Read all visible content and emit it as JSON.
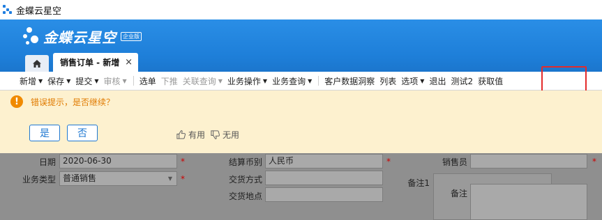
{
  "window": {
    "title": "金蝶云星空"
  },
  "header": {
    "brand": "金蝶云星空",
    "edition": "企业版",
    "active_tab": "销售订单 - 新增",
    "close_glyph": "×"
  },
  "toolbar": {
    "items": [
      {
        "label": "新增",
        "dropdown": true,
        "disabled": false
      },
      {
        "label": "保存",
        "dropdown": true,
        "disabled": false
      },
      {
        "label": "提交",
        "dropdown": true,
        "disabled": false
      },
      {
        "label": "审核",
        "dropdown": true,
        "disabled": true
      },
      {
        "label": "选单",
        "dropdown": false,
        "disabled": false
      },
      {
        "label": "下推",
        "dropdown": false,
        "disabled": true
      },
      {
        "label": "关联查询",
        "dropdown": true,
        "disabled": true
      },
      {
        "label": "业务操作",
        "dropdown": true,
        "disabled": false
      },
      {
        "label": "业务查询",
        "dropdown": true,
        "disabled": false
      },
      {
        "label": "客户数据洞察",
        "dropdown": false,
        "disabled": false
      },
      {
        "label": "列表",
        "dropdown": false,
        "disabled": false
      },
      {
        "label": "选项",
        "dropdown": true,
        "disabled": false
      },
      {
        "label": "退出",
        "dropdown": false,
        "disabled": false
      },
      {
        "label": "测试2",
        "dropdown": false,
        "disabled": false
      },
      {
        "label": "获取值",
        "dropdown": false,
        "disabled": false
      }
    ]
  },
  "message": {
    "text": "错误提示，是否继续？",
    "yes": "是",
    "no": "否",
    "useful": "有用",
    "useless": "无用",
    "accent": "#e07a00"
  },
  "form": {
    "date_label": "日期",
    "date_value": "2020-06-30",
    "biztype_label": "业务类型",
    "biztype_value": "普通销售",
    "currency_label": "结算币别",
    "currency_value": "人民币",
    "delivery_method_label": "交货方式",
    "delivery_place_label": "交货地点",
    "salesman_label": "销售员",
    "note1_label": "备注1",
    "note_label": "备注",
    "required_mark": "*"
  }
}
